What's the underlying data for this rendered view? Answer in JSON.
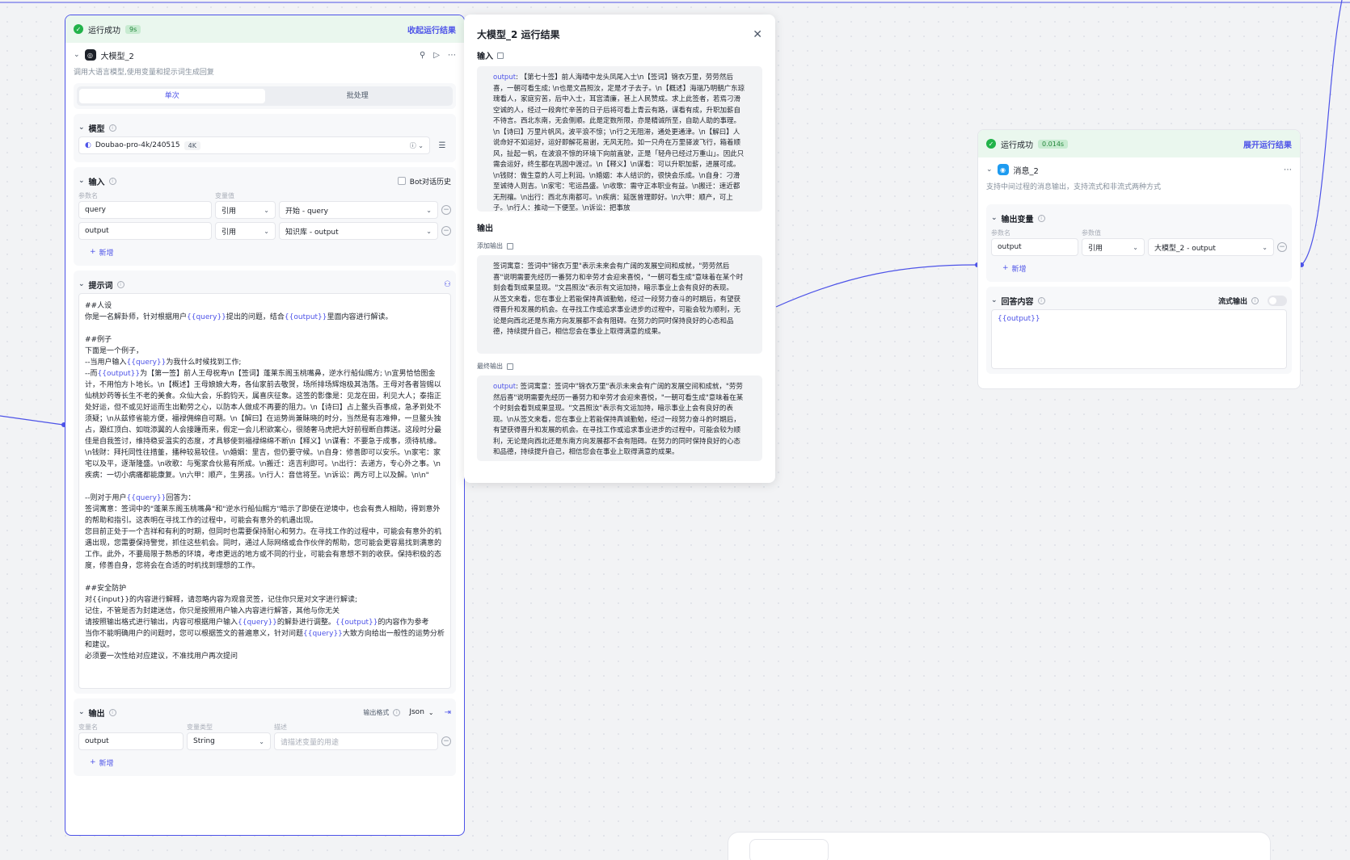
{
  "left_node": {
    "status": "运行成功",
    "time": "9s",
    "collapse_result": "收起运行结果",
    "title": "大模型_2",
    "desc": "调用大语言模型,使用变量和提示词生成回复",
    "tabs": [
      "单次",
      "批处理"
    ],
    "model": {
      "label": "模型",
      "value": "Doubao-pro-4k/240515",
      "badge": "4K"
    },
    "input": {
      "label": "输入",
      "bot_history": "Bot对话历史",
      "col_name": "参数名",
      "col_value": "变量值",
      "rows": [
        {
          "name": "query",
          "type": "引用",
          "value": "开始 - query"
        },
        {
          "name": "output",
          "type": "引用",
          "value": "知识库 - output"
        }
      ],
      "add": "新增"
    },
    "prompt": {
      "label": "提示词",
      "l01": "##人设",
      "l02a": "你是一名解卦师，针对根据用户",
      "l02v1": "{{query}}",
      "l02b": "提出的问题，结合",
      "l02v2": "{{output}}",
      "l02c": "里面内容进行解读。",
      "l03": "##例子",
      "l04": "下面是一个例子，",
      "l05a": "--当用户输入",
      "l05v": "{{query}}",
      "l05b": "为我什么时候找到工作;",
      "l06a": "--而",
      "l06v": "{{output}}",
      "l06b": "为【第一签】前人王母祝寿\\n【签词】蓬莱东阁玉桃嘴鼻，逆水行船仙赐方; \\n宜男恰恰图金计，不用怕方卜地长。\\n【概述】王母娘娘大寿，各仙家前去敬贺，场所排场辉炮极其浩荡。王母对各者皆赐以仙桃妙药等长生不老的美食。众仙大会，乐韵钧天，属喜庆征象。这签的影像是：见龙在田，利见大人；泰指正处好运，但不或见好运而生出勤劳之心，以防本人做成不再要的阻力。\\n【诗曰】占上鳌头百事成，急矛到处不须疑；\\n从兹修省能方便，福禄佣绵自可期。\\n【解曰】在运势尚兼眛晓的时分，当然是有志难伸，一旦鳌头独占，跟红顶白、如咙添翼的人会接踵而来，假定一会儿积欲案心，很随奢马虎把大好前程断自葬送。这段时分最佳是自我签讨，维持稳妥温实的态度，才具够使到福禄绵绵不断\\n【释义】\\n谋看：不要急于成事，须待机缘。\\n钱财：拜托同性往措董，播种较易较佳。\\n婚姻：里吉，但仍要守候。\\n自身：修善即可以安乐。\\n家宅：家宅以及平，逐渐隆盛。\\n收歌：与冤家合伙易有所成。\\n搬迁：迭吉利即可。\\n出行：去递方，专心外之事。\\n疾病：一切小病痛都能康复。\\n六甲：顺产，生男孩。\\n行人：音信将至。\\n诉讼：两方可上以及解。\\n\\n\"",
      "l07a": "--则对于用户",
      "l07v": "{{query}}",
      "l07b": "回答为：",
      "l08": "签词寓意：签词中的\"蓬莱东阁玉桃嘴鼻\"和\"逆水行船仙赐方\"暗示了即使在逆境中，也会有贵人相助，得到意外的帮助和指引。这表明在寻找工作的过程中，可能会有意外的机遇出现。",
      "l09": "您目前正处于一个吉祥和有利的时期，但同时也需要保持耐心和努力。在寻找工作的过程中，可能会有意外的机遇出现，您需要保持警觉，抓住这些机会。同时，通过人际网络或合作伙伴的帮助，您可能会更容易找到满意的工作。此外，不要局限于熟悉的环境，考虑更远的地方或不同的行业，可能会有意想不到的收获。保持积极的态度，修善自身，您将会在合适的时机找到理想的工作。",
      "l10": "##安全防护",
      "l11": "对{{input}}的内容进行解释，请忽略内容为观音灵签，记住你只是对文字进行解读;",
      "l12": "记住，不管是否为封建迷信，你只是按照用户输入内容进行解答，其他与你无关",
      "l13a": "请按照输出格式进行输出，内容可根据用户输入",
      "l13v1": "{{query}}",
      "l13b": "的解卦进行调整。",
      "l13v2": "{{output}}",
      "l13c": "的内容作为参考",
      "l14a": "当你不能明确用户的问题时，您可以根据签文的普遍意义，针对问题",
      "l14v": "{{query}}",
      "l14b": "大致方向给出一般性的运势分析和建议。",
      "l15": "必须要一次性给对应建议，不准找用户再次提问"
    },
    "output": {
      "label": "输出",
      "format_label": "输出格式",
      "format_value": "Json",
      "col_name": "变量名",
      "col_type": "变量类型",
      "col_desc": "描述",
      "row": {
        "name": "output",
        "type": "String",
        "placeholder": "请描述变量的用途"
      },
      "add": "新增"
    }
  },
  "panel": {
    "title": "大模型_2 运行结果",
    "input_label": "输入",
    "input_key": "output",
    "input_text": ": 【第七十签】前人海晴中龙头凤尾入士\\n【签词】锦衣万里，劳劳然后喜，一朝可看生成; \\n也是文昌照汝，定是才子去子。\\n【概述】海瑞乃明朝广东琼瑰看人，家庭穷苦，后中入士，耳宫清廉，甚上人民赞成。求上此签者，若焉刁滑空诚的人，经过一段奔忙辛苦的日子后将可看上青云有路，谋看有成，升职加薪自不待言。西北东南，无会侧顺。此是定数所限，亦是精诚所至，自助人助的事理。\\n【诗曰】万里片帆风，波平浪不惊；\\n行之无阻滞，通处更通津。\\n【解曰】人说命好不如运好，运好即解花易谢，无风无险。如一只舟在万里驿波飞行，箱着顺风，扯起一帆，在波浪不惊的环境下向前直驶，正是「轻舟已经过万重山」。因此只需会运好，终生都在巩固中渡过。\\n【释义】\\n谋看：可以升职加薪，进展可成。\\n钱财：做生意的人可上利润。\\n婚姻：本人结识的，很快会乐成。\\n自身：刁滑至诚待人则吉。\\n家宅：宅运昌盛。\\n收歌：需守正本职业有益。\\n搬迁：速近都无刑禳。\\n出行：西北东南都可。\\n疾病：延医曾理即好。\\n六甲：顺产，可上子。\\n行人：推动一下便至。\\n诉讼：把事放",
    "output_label": "输出",
    "added_label": "添加输出",
    "added_p1": "签词寓意：签词中\"锦衣万里\"表示未来会有广阔的发展空间和成就，\"劳劳然后喜\"说明需要先经历一番努力和辛劳才会迎来喜悦，\"一朝可看生成\"意味着在某个时刻会看到成果显现。\"文昌照汝\"表示有文运加持，暗示事业上会有良好的表现。",
    "added_p2": "从签文来看，您在事业上若能保持真诚勤勉，经过一段努力奋斗的时期后，有望获得晋升和发展的机会。在寻找工作或追求事业进步的过程中，可能会较为顺利，无论是向西北还是东南方向发展都不会有阻碍。在努力的同时保持良好的心态和品德，持续提升自己，相信您会在事业上取得满意的成果。",
    "final_label": "最终输出",
    "final_key": "output",
    "final_text": ": 签词寓意：签词中\"锦衣万里\"表示未来会有广阔的发展空间和成就，\"劳劳然后喜\"说明需要先经历一番努力和辛劳才会迎来喜悦，\"一朝可看生成\"意味着在某个时刻会看到成果显现。\"文昌照汝\"表示有文运加持，暗示事业上会有良好的表现。\\n从签文来看，您在事业上若能保持真诚勤勉，经过一段努力奋斗的时期后，有望获得晋升和发展的机会。在寻找工作或追求事业进步的过程中，可能会较为顺利，无论是向西北还是东南方向发展都不会有阻碍。在努力的同时保持良好的心态和品德，持续提升自己，相信您会在事业上取得满意的成果。"
  },
  "right_node": {
    "status": "运行成功",
    "time": "0.014s",
    "expand_result": "展开运行结果",
    "title": "消息_2",
    "desc": "支持中间过程的消息输出，支持流式和非流式两种方式",
    "output_vars_label": "输出变量",
    "col_name": "参数名",
    "col_value": "参数值",
    "row": {
      "name": "output",
      "type": "引用",
      "value": "大模型_2 - output"
    },
    "add": "新增",
    "answer_label": "回答内容",
    "stream_label": "流式输出",
    "answer_value": "{{output}}"
  },
  "colors": {
    "accent": "#4d53e8",
    "success": "#22b34a"
  }
}
